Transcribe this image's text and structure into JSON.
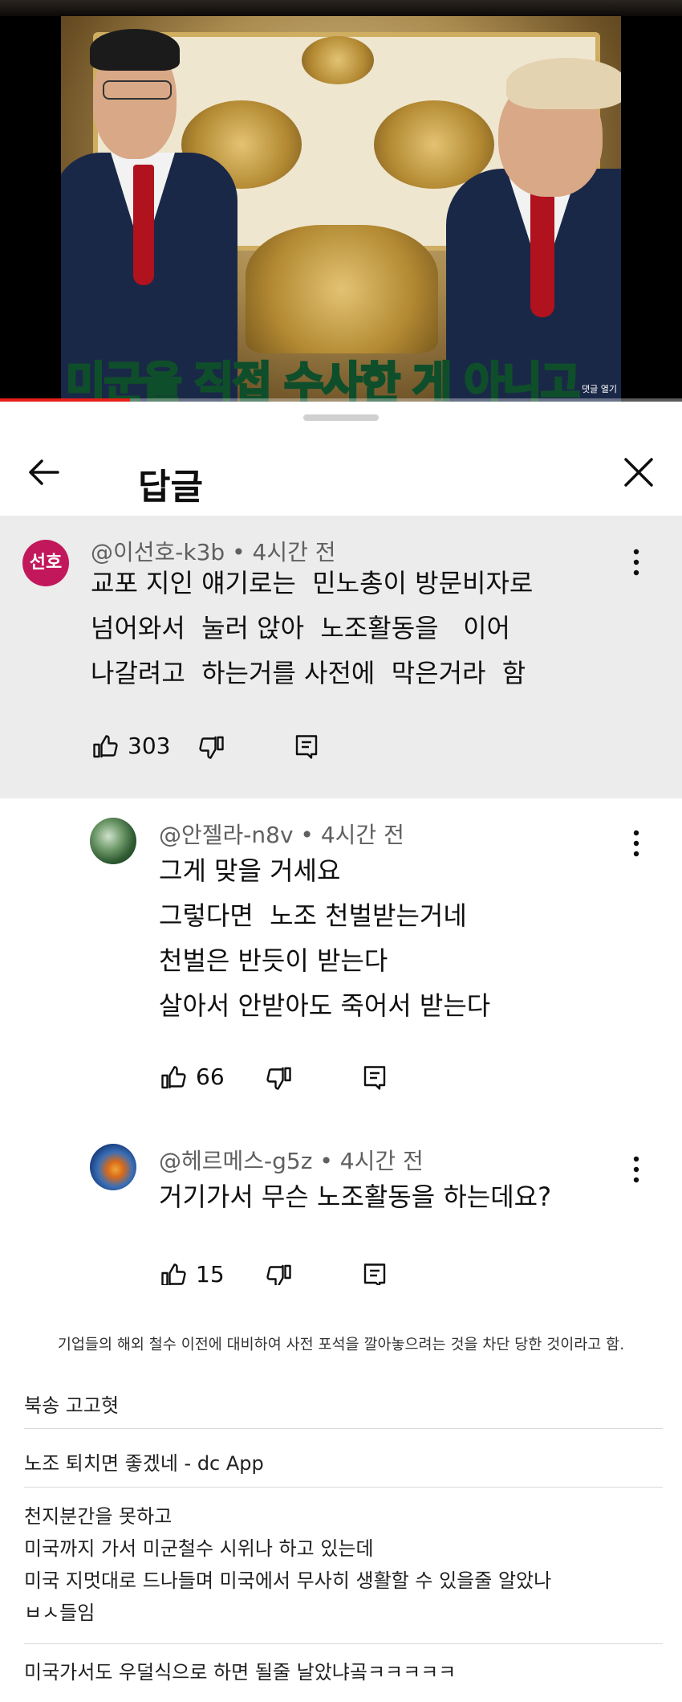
{
  "video": {
    "subtitle": "미군을 직접 수사한 게 아니고",
    "comment_toggle": "댓글 열기",
    "progress": 0.19
  },
  "sheet": {
    "title": "답글"
  },
  "comments": [
    {
      "avatar_text": "선호",
      "author": "@이선호-k3b",
      "time": "4시간 전",
      "lines": [
        "교포 지인 얘기로는  민노총이 방문비자로",
        "넘어와서  눌러 앉아  노조활동을   이어",
        "나갈려고  하는거를 사전에  막은거라  함"
      ],
      "likes": "303"
    },
    {
      "author": "@안젤라-n8v",
      "time": "4시간 전",
      "lines": [
        "그게 맞을 거세요",
        "그렇다면  노조 천벌받는거네",
        "천벌은 반듯이 받는다",
        "살아서 안받아도 죽어서 받는다"
      ],
      "likes": "66"
    },
    {
      "author": "@헤르메스-g5z",
      "time": "4시간 전",
      "lines": [
        "거기가서 무슨 노조활동을 하는데요?"
      ],
      "likes": "15"
    }
  ],
  "dc": {
    "summary": "기업들의 해외 철수 이전에 대비하여 사전 포석을 깔아놓으려는 것을 차단 당한 것이라고 함.",
    "items": [
      {
        "lines": [
          "북송 고고혓"
        ]
      },
      {
        "lines": [
          "노조 퇴치면 좋겠네 - dc App"
        ]
      },
      {
        "lines": [
          "천지분간을 못하고",
          "미국까지 가서 미군철수 시위나 하고 있는데",
          "미국 지멋대로 드나들며 미국에서 무사히 생활할 수 있을줄 알았나",
          "ㅂㅅ들임"
        ]
      },
      {
        "lines": [
          "미국가서도 우덜식으로 하면 될줄 날았냐곸ㅋㅋㅋㅋㅋ"
        ]
      }
    ]
  },
  "colors": {
    "subtitle": "#2fd37a",
    "progress": "#e62117",
    "highlight_bg": "#ececec",
    "avatar_1": "#c2185b"
  }
}
